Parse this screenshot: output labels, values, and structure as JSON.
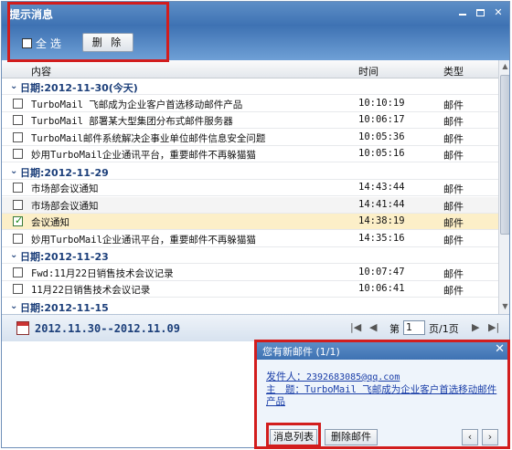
{
  "window": {
    "title": "提示消息"
  },
  "toolbar": {
    "select_all_label": "全 选",
    "delete_label": "删 除"
  },
  "columns": {
    "content": "内容",
    "time": "时间",
    "type": "类型"
  },
  "groups": [
    {
      "label": "日期:2012-11-30(今天)",
      "items": [
        {
          "subject": "TurboMail 飞邮成为企业客户首选移动邮件产品",
          "time": "10:10:19",
          "type": "邮件",
          "checked": false
        },
        {
          "subject": "TurboMail 部署某大型集团分布式邮件服务器",
          "time": "10:06:17",
          "type": "邮件",
          "checked": false
        },
        {
          "subject": "TurboMail邮件系统解决企事业单位邮件信息安全问题",
          "time": "10:05:36",
          "type": "邮件",
          "checked": false
        },
        {
          "subject": "妙用TurboMail企业通讯平台，重要邮件不再躲猫猫",
          "time": "10:05:16",
          "type": "邮件",
          "checked": false
        }
      ]
    },
    {
      "label": "日期:2012-11-29",
      "items": [
        {
          "subject": "市场部会议通知",
          "time": "14:43:44",
          "type": "邮件",
          "checked": false
        },
        {
          "subject": "市场部会议通知",
          "time": "14:41:44",
          "type": "邮件",
          "checked": false
        },
        {
          "subject": "会议通知",
          "time": "14:38:19",
          "type": "邮件",
          "checked": true
        },
        {
          "subject": "妙用TurboMail企业通讯平台，重要邮件不再躲猫猫",
          "time": "14:35:16",
          "type": "邮件",
          "checked": false
        }
      ]
    },
    {
      "label": "日期:2012-11-23",
      "items": [
        {
          "subject": "Fwd:11月22日销售技术会议记录",
          "time": "10:07:47",
          "type": "邮件",
          "checked": false
        },
        {
          "subject": "11月22日销售技术会议记录",
          "time": "10:06:41",
          "type": "邮件",
          "checked": false
        }
      ]
    },
    {
      "label": "日期:2012-11-15",
      "items": []
    }
  ],
  "footer": {
    "date_range": "2012.11.30--2012.11.09",
    "page_label": "第",
    "page_value": "1",
    "page_total": "页/1页"
  },
  "popup": {
    "title": "您有新邮件 (1/1)",
    "sender_label": "发件人：",
    "sender_email": "2392683085@qq.com",
    "subject_label": "主　题：",
    "subject_text": "TurboMail 飞邮成为企业客户首选移动邮件产品",
    "list_button": "消息列表",
    "delete_button": "删除邮件"
  },
  "colors": {
    "title_bar": "#3e72b3",
    "highlight_row": "#fcefc8",
    "group_text": "#1c3f7a",
    "annotation": "#d21d1d"
  }
}
